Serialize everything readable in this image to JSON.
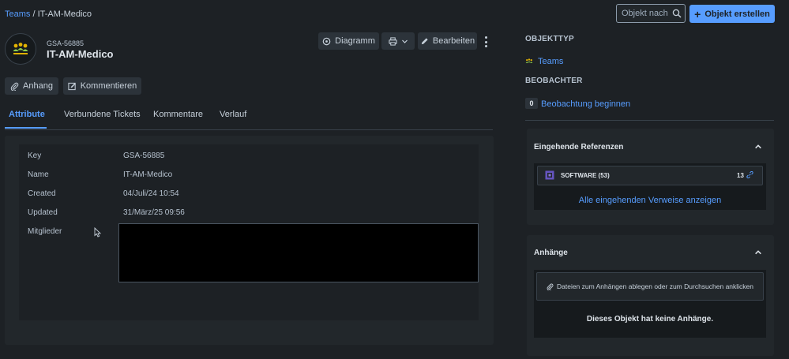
{
  "breadcrumb": {
    "root": "Teams",
    "separator": " / ",
    "current": "IT-AM-Medico"
  },
  "search": {
    "placeholder": "Objekt nach ..."
  },
  "header_actions": {
    "create_label": "Objekt erstellen"
  },
  "object": {
    "key": "GSA-56885",
    "name": "IT-AM-Medico"
  },
  "toolbar": {
    "diagram_label": "Diagramm",
    "edit_label": "Bearbeiten"
  },
  "actions": {
    "attach_label": "Anhang",
    "comment_label": "Kommentieren"
  },
  "tabs": [
    {
      "label": "Attribute"
    },
    {
      "label": "Verbundene Tickets"
    },
    {
      "label": "Kommentare"
    },
    {
      "label": "Verlauf"
    }
  ],
  "attributes": [
    {
      "label": "Key",
      "value": "GSA-56885"
    },
    {
      "label": "Name",
      "value": "IT-AM-Medico"
    },
    {
      "label": "Created",
      "value": "04/Juli/24 10:54"
    },
    {
      "label": "Updated",
      "value": "31/März/25 09:56"
    },
    {
      "label": "Mitglieder",
      "value": ""
    }
  ],
  "sidebar": {
    "object_type_title": "OBJEKTTYP",
    "object_type_value": "Teams",
    "watchers_title": "BEOBACHTER",
    "watchers_count": "0",
    "watch_label": "Beobachtung beginnen",
    "incoming_title": "Eingehende Referenzen",
    "reference_label": "SOFTWARE (53)",
    "reference_count": "13",
    "show_all_label": "Alle eingehenden Verweise anzeigen",
    "attachments_title": "Anhänge",
    "dropzone_label": "Dateien zum Anhängen ablegen oder zum Durchsuchen anklicken",
    "no_attachments_label": "Dieses Objekt hat keine Anhänge."
  },
  "colors": {
    "accent": "#579dff",
    "background": "#1d2125",
    "surface": "#22272b",
    "button": "#2c333a"
  }
}
